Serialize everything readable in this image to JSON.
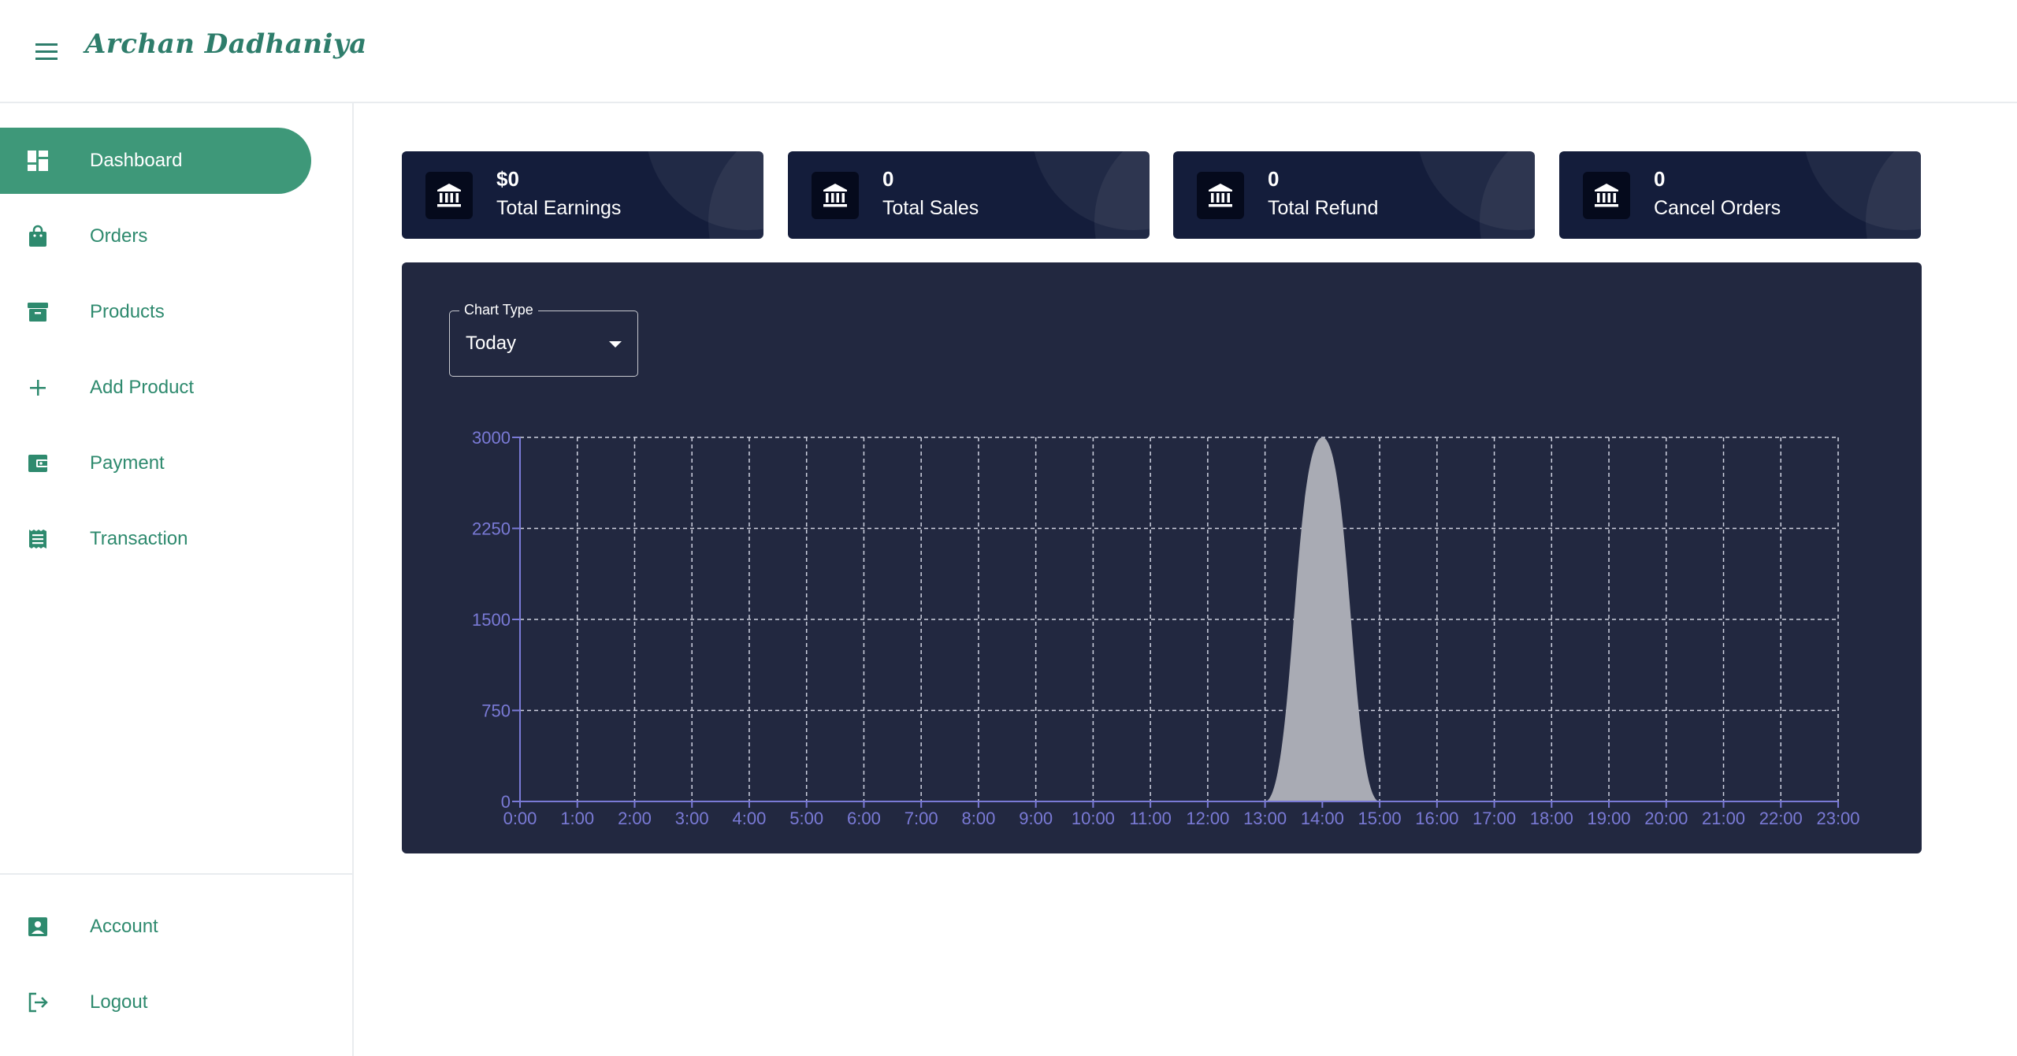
{
  "header": {
    "brand": "Archan Dadhaniya",
    "menu_icon": "hamburger-menu-icon"
  },
  "sidebar": {
    "items": [
      {
        "label": "Dashboard",
        "icon": "dashboard-icon",
        "active": true
      },
      {
        "label": "Orders",
        "icon": "shopping-bag-icon",
        "active": false
      },
      {
        "label": "Products",
        "icon": "archive-box-icon",
        "active": false
      },
      {
        "label": "Add Product",
        "icon": "plus-icon",
        "active": false
      },
      {
        "label": "Payment",
        "icon": "wallet-icon",
        "active": false
      },
      {
        "label": "Transaction",
        "icon": "receipt-icon",
        "active": false
      }
    ],
    "bottom_items": [
      {
        "label": "Account",
        "icon": "account-box-icon"
      },
      {
        "label": "Logout",
        "icon": "logout-icon"
      }
    ]
  },
  "stats": [
    {
      "value": "$0",
      "label": "Total Earnings",
      "icon": "bank-icon"
    },
    {
      "value": "0",
      "label": "Total Sales",
      "icon": "bank-icon"
    },
    {
      "value": "0",
      "label": "Total Refund",
      "icon": "bank-icon"
    },
    {
      "value": "0",
      "label": "Cancel Orders",
      "icon": "bank-icon"
    }
  ],
  "chart_filter": {
    "legend": "Chart Type",
    "value": "Today"
  },
  "colors": {
    "accent": "#3e9879",
    "accent_text": "#2e8a6e",
    "card_bg": "#141d3b",
    "chart_bg": "#222840",
    "axis": "#7a7ad6",
    "area_fill": "#a9abb4"
  },
  "chart_data": {
    "type": "area",
    "x": [
      "0:00",
      "1:00",
      "2:00",
      "3:00",
      "4:00",
      "5:00",
      "6:00",
      "7:00",
      "8:00",
      "9:00",
      "10:00",
      "11:00",
      "12:00",
      "13:00",
      "14:00",
      "15:00",
      "16:00",
      "17:00",
      "18:00",
      "19:00",
      "20:00",
      "21:00",
      "22:00",
      "23:00"
    ],
    "values": [
      0,
      0,
      0,
      0,
      0,
      0,
      0,
      0,
      0,
      0,
      0,
      0,
      0,
      0,
      3000,
      0,
      0,
      0,
      0,
      0,
      0,
      0,
      0,
      0
    ],
    "yticks": [
      0,
      750,
      1500,
      2250,
      3000
    ],
    "ylim": [
      0,
      3000
    ],
    "grid": true,
    "curve": "smooth"
  }
}
